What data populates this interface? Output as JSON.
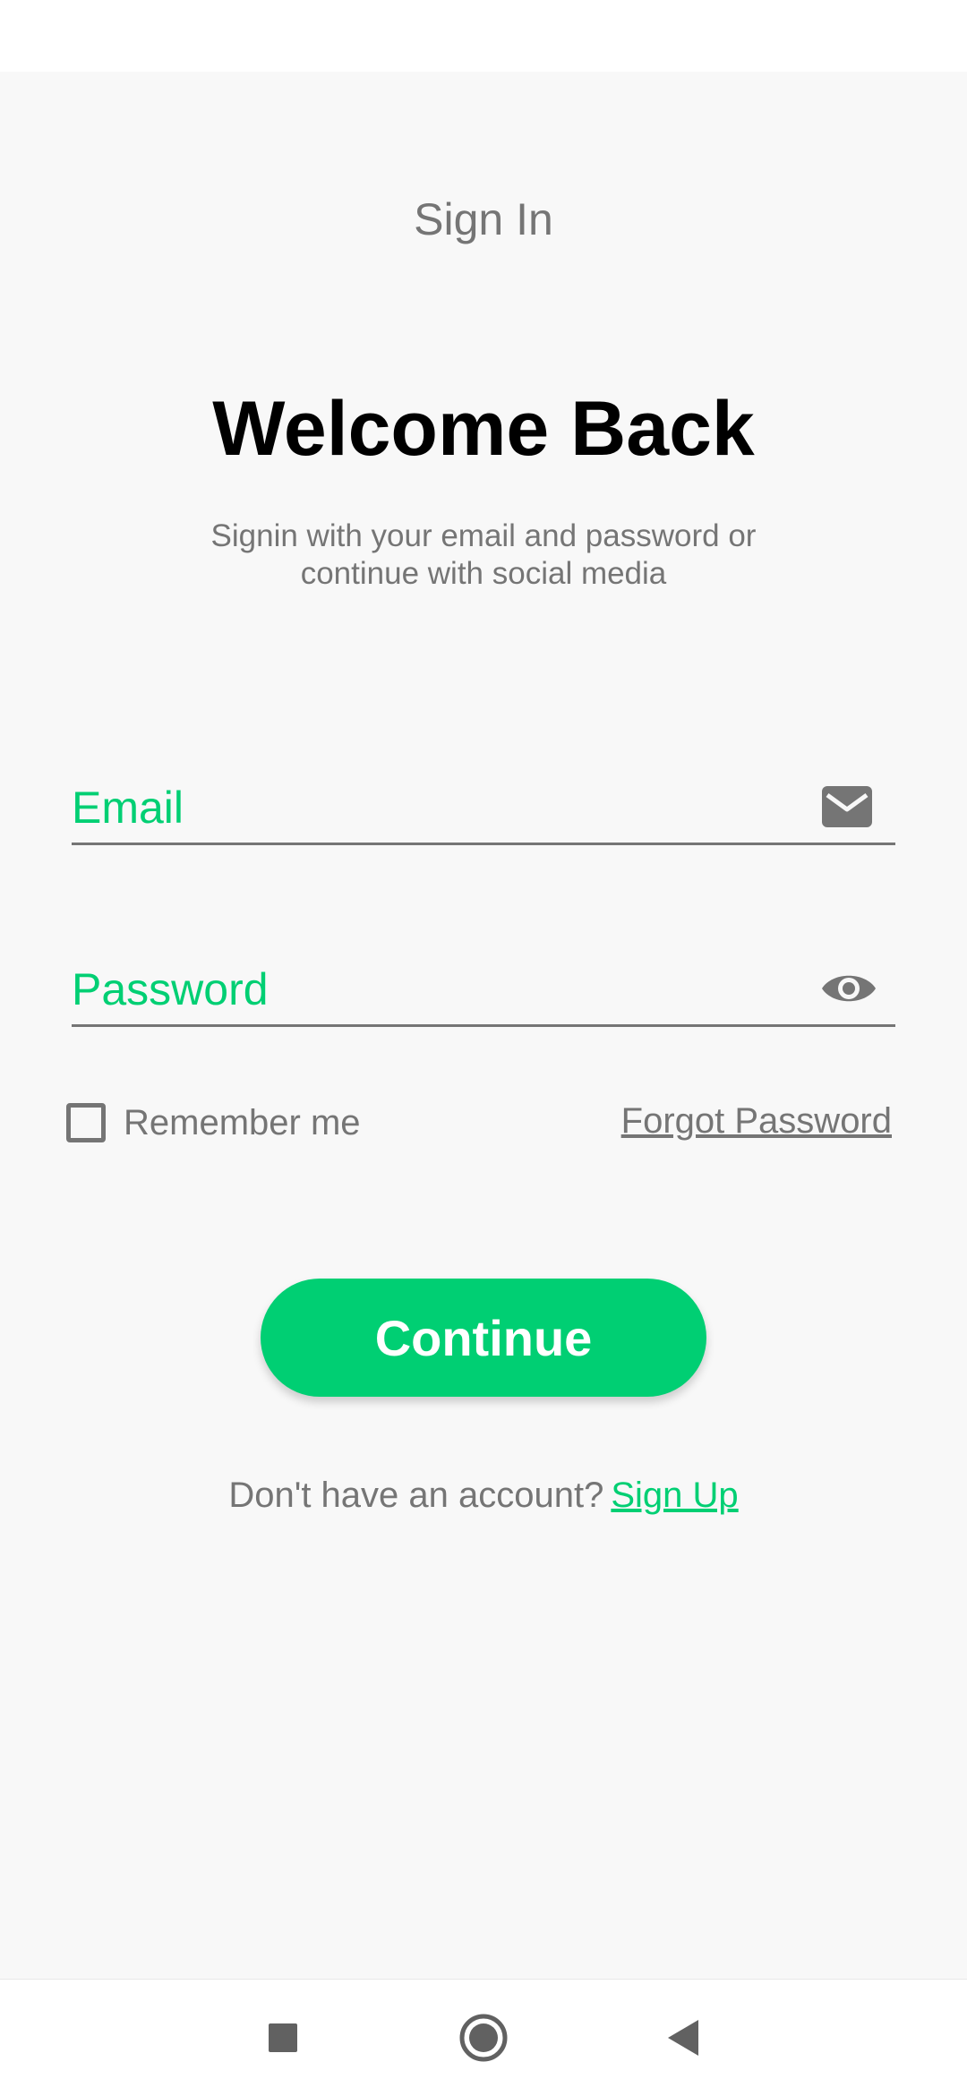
{
  "header": {
    "title": "Sign In"
  },
  "welcome": {
    "heading": "Welcome Back",
    "subtitle": "Signin with your email and password or continue with social media"
  },
  "form": {
    "email": {
      "placeholder": "Email",
      "value": "",
      "icon": "envelope-icon"
    },
    "password": {
      "placeholder": "Password",
      "value": "",
      "icon": "eye-icon"
    },
    "remember_label": "Remember me",
    "remember_checked": false,
    "forgot_label": "Forgot Password",
    "continue_label": "Continue"
  },
  "footer": {
    "prompt": "Don't have an account?",
    "signup_label": "Sign Up"
  },
  "system_nav": {
    "items": [
      "recents-icon",
      "home-icon",
      "back-icon"
    ]
  },
  "colors": {
    "accent": "#00CF73",
    "text_secondary": "#757575",
    "background": "#F8F8F8"
  }
}
